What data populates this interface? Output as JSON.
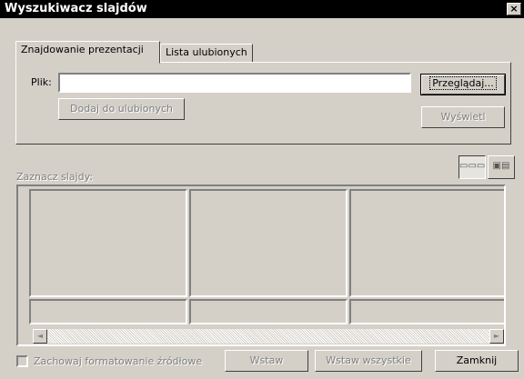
{
  "window": {
    "title": "Wyszukiwacz slajdów",
    "close_glyph": "×"
  },
  "tabs": [
    {
      "label": "Znajdowanie prezentacji",
      "active": true
    },
    {
      "label": "Lista ulubionych",
      "active": false
    }
  ],
  "file": {
    "label": "Plik:",
    "value": ""
  },
  "buttons": {
    "browse": "Przeglądaj...",
    "add_favorites": "Dodaj do ulubionych",
    "display": "Wyświetl",
    "insert": "Wstaw",
    "insert_all": "Wstaw wszystkie",
    "close": "Zamknij"
  },
  "slides": {
    "label": "Zaznacz slajdy:"
  },
  "view_buttons": [
    {
      "icon": "slide-strip-view-icon",
      "glyph": "▭▭▭",
      "pressed": true
    },
    {
      "icon": "slide-detail-view-icon",
      "glyph": "▣▤",
      "pressed": false
    }
  ],
  "scroll": {
    "left_glyph": "◄",
    "right_glyph": "►"
  },
  "keep_format": {
    "label": "Zachowaj formatowanie źródłowe",
    "checked": false
  },
  "colors": {
    "title_bg": "#000000",
    "face": "#d4d0c8",
    "disabled_text": "#808080"
  }
}
